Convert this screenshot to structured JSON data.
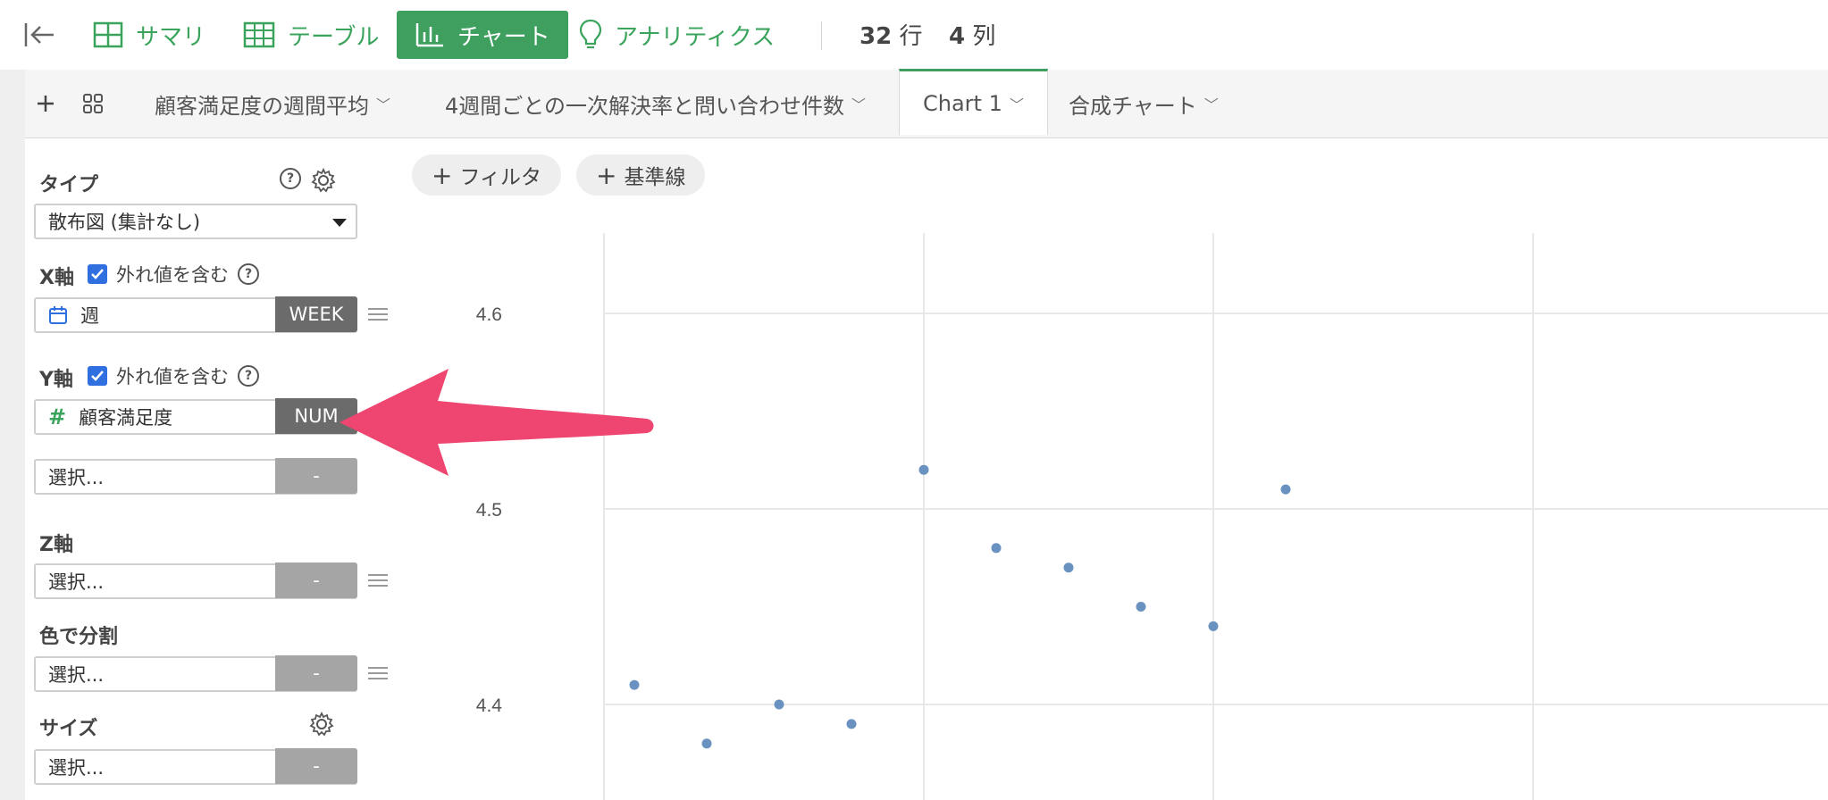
{
  "toolbar": {
    "summary": "サマリ",
    "table": "テーブル",
    "chart": "チャート",
    "analytics": "アナリティクス",
    "rows_count": "32",
    "rows_unit": "行",
    "cols_count": "4",
    "cols_unit": "列"
  },
  "tabs": [
    {
      "label": "顧客満足度の週間平均"
    },
    {
      "label": "4週間ごとの一次解決率と問い合わせ件数"
    },
    {
      "label": "Chart 1"
    },
    {
      "label": "合成チャート"
    }
  ],
  "panel": {
    "type_label": "タイプ",
    "type_value": "散布図 (集計なし)",
    "x_label": "X軸",
    "include_outliers": "外れ値を含む",
    "x_field": "週",
    "x_type": "WEEK",
    "y_label": "Y軸",
    "y_field": "顧客満足度",
    "y_type": "NUM",
    "y2_placeholder": "選択...",
    "dash": "-",
    "z_label": "Z軸",
    "z_placeholder": "選択...",
    "color_label": "色で分割",
    "color_placeholder": "選択...",
    "size_label": "サイズ",
    "size_placeholder": "選択..."
  },
  "chart_actions": {
    "filter": "フィルタ",
    "reference_line": "基準線"
  },
  "chart_data": {
    "type": "scatter",
    "title": "",
    "xlabel": "",
    "ylabel": "",
    "y_ticks": [
      4.6,
      4.5,
      4.4
    ],
    "ylim": [
      4.34,
      4.64
    ],
    "x": [
      1,
      2,
      3,
      4,
      5,
      6,
      7,
      8,
      9,
      10
    ],
    "values": [
      4.41,
      4.38,
      4.4,
      4.39,
      4.52,
      4.48,
      4.47,
      4.45,
      4.44,
      4.51
    ],
    "grid": true,
    "point_color": "#6a92c0"
  },
  "colors": {
    "accent_green": "#3f9f5f",
    "checkbox_blue": "#2f6fe0",
    "annotation_arrow": "#ee4670"
  }
}
